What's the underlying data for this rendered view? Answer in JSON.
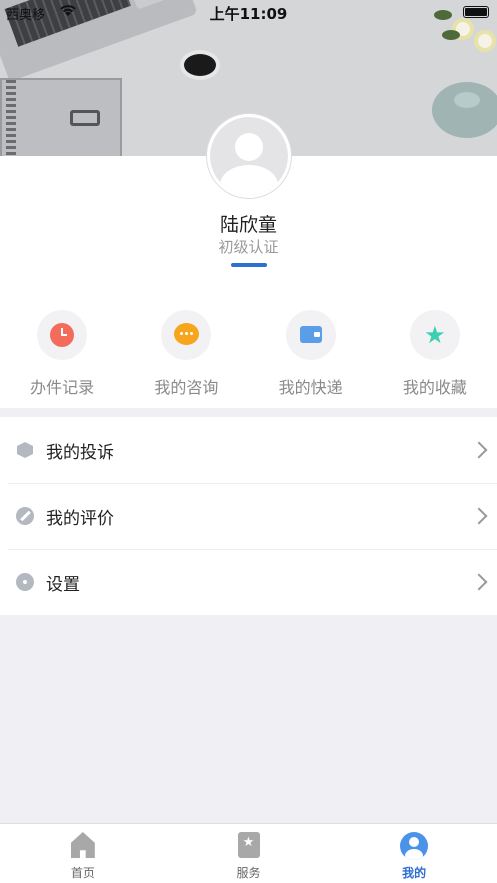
{
  "status_bar": {
    "carrier": "西奥移",
    "time": "上午11:09"
  },
  "profile": {
    "name": "陆欣童",
    "level": "初级认证"
  },
  "quick_actions": [
    {
      "label": "办件记录",
      "icon": "clock-icon",
      "color": "#f26b5b"
    },
    {
      "label": "我的咨询",
      "icon": "chat-bubble-icon",
      "color": "#f7a51c"
    },
    {
      "label": "我的快递",
      "icon": "wallet-icon",
      "color": "#5a9de8"
    },
    {
      "label": "我的收藏",
      "icon": "star-icon",
      "color": "#3ccfb0"
    }
  ],
  "menu": [
    {
      "label": "我的投诉",
      "icon": "cube-icon"
    },
    {
      "label": "我的评价",
      "icon": "pen-icon"
    },
    {
      "label": "设置",
      "icon": "gear-icon"
    }
  ],
  "tabbar": [
    {
      "label": "首页",
      "icon": "home-icon"
    },
    {
      "label": "服务",
      "icon": "bookmark-icon"
    },
    {
      "label": "我的",
      "icon": "user-icon",
      "active": true
    }
  ],
  "colors": {
    "accent": "#2d6fd1",
    "background": "#efeff4"
  }
}
